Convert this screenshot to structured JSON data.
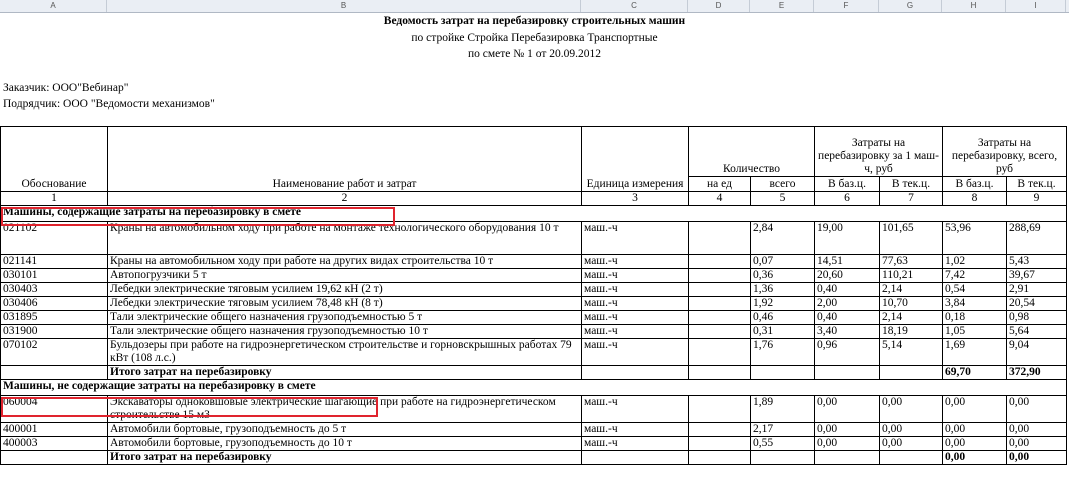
{
  "column_letters": [
    "A",
    "B",
    "C",
    "D",
    "E",
    "F",
    "G",
    "H",
    "I"
  ],
  "doc": {
    "title": "Ведомость затрат на перебазировку строительных машин",
    "subtitle": "по стройке Стройка Перебазировка Транспортные",
    "estimate": "по смете № 1 от 20.09.2012",
    "customer": "Заказчик: ООО\"Вебинар\"",
    "contractor": "Подрядчик: ООО \"Ведомости механизмов\""
  },
  "table": {
    "h_basis": "Обоснование",
    "h_name": "Наименование работ и затрат",
    "h_unit": "Единица измерения",
    "h_qty": "Количество",
    "h_qty_per": "на ед",
    "h_qty_total": "всего",
    "h_cost1": "Затраты на перебазировку за 1 маш-ч, руб",
    "h_costall": "Затраты на перебазировку, всего, руб",
    "h_base": "В баз.ц.",
    "h_cur": "В тек.ц.",
    "nums": [
      "1",
      "2",
      "3",
      "4",
      "5",
      "6",
      "7",
      "8",
      "9"
    ],
    "section1": "Машины, содержащие затраты на перебазировку в смете",
    "rows1": [
      {
        "code": "021102",
        "name": "Краны на автомобильном ходу при работе на монтаже технологического оборудования 10 т",
        "unit": "маш.-ч",
        "total": "2,84",
        "b1": "19,00",
        "c1": "101,65",
        "b2": "53,96",
        "c2": "288,69"
      },
      {
        "code": "021141",
        "name": "Краны на автомобильном ходу при работе на других видах строительства 10 т",
        "unit": "маш.-ч",
        "total": "0,07",
        "b1": "14,51",
        "c1": "77,63",
        "b2": "1,02",
        "c2": "5,43"
      },
      {
        "code": "030101",
        "name": "Автопогрузчики 5 т",
        "unit": "маш.-ч",
        "total": "0,36",
        "b1": "20,60",
        "c1": "110,21",
        "b2": "7,42",
        "c2": "39,67"
      },
      {
        "code": "030403",
        "name": "Лебедки электрические тяговым усилием 19,62 кН (2 т)",
        "unit": "маш.-ч",
        "total": "1,36",
        "b1": "0,40",
        "c1": "2,14",
        "b2": "0,54",
        "c2": "2,91"
      },
      {
        "code": "030406",
        "name": "Лебедки электрические тяговым усилием 78,48 кН (8 т)",
        "unit": "маш.-ч",
        "total": "1,92",
        "b1": "2,00",
        "c1": "10,70",
        "b2": "3,84",
        "c2": "20,54"
      },
      {
        "code": "031895",
        "name": "Тали электрические общего назначения грузоподъемностью 5 т",
        "unit": "маш.-ч",
        "total": "0,46",
        "b1": "0,40",
        "c1": "2,14",
        "b2": "0,18",
        "c2": "0,98"
      },
      {
        "code": "031900",
        "name": "Тали электрические общего назначения грузоподъемностью 10 т",
        "unit": "маш.-ч",
        "total": "0,31",
        "b1": "3,40",
        "c1": "18,19",
        "b2": "1,05",
        "c2": "5,64"
      },
      {
        "code": "070102",
        "name": "Бульдозеры при работе на гидроэнергетическом строительстве и горновскрышных работах 79 кВт (108 л.с.)",
        "unit": "маш.-ч",
        "total": "1,76",
        "b1": "0,96",
        "c1": "5,14",
        "b2": "1,69",
        "c2": "9,04"
      }
    ],
    "total_label": "Итого затрат на перебазировку",
    "total1_base": "69,70",
    "total1_cur": "372,90",
    "section2": "Машины, не содержащие затраты на перебазировку в смете",
    "rows2": [
      {
        "code": "060004",
        "name": "Экскаваторы одноковшовые электрические шагающие при работе на гидроэнергетическом строительстве 15 м3",
        "unit": "маш.-ч",
        "total": "1,89",
        "b1": "0,00",
        "c1": "0,00",
        "b2": "0,00",
        "c2": "0,00"
      },
      {
        "code": "400001",
        "name": "Автомобили бортовые, грузоподъемность до 5 т",
        "unit": "маш.-ч",
        "total": "2,17",
        "b1": "0,00",
        "c1": "0,00",
        "b2": "0,00",
        "c2": "0,00"
      },
      {
        "code": "400003",
        "name": "Автомобили бортовые, грузоподъемность до 10 т",
        "unit": "маш.-ч",
        "total": "0,55",
        "b1": "0,00",
        "c1": "0,00",
        "b2": "0,00",
        "c2": "0,00"
      }
    ],
    "total2_base": "0,00",
    "total2_cur": "0,00"
  },
  "highlight_color": "#e0242e"
}
